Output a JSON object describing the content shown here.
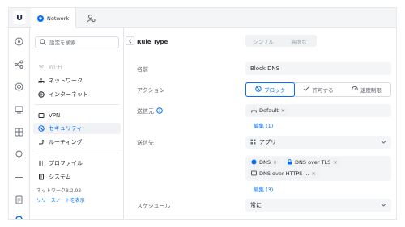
{
  "topbar": {
    "logo_letter": "U",
    "tab_network_label": "Network",
    "accent_color": "#006fff"
  },
  "rail_icons": [
    "dashboard-icon",
    "topology-icon",
    "devices-icon",
    "clients-icon",
    "stats-icon",
    "insights-icon",
    "alerts-icon",
    "logs-icon",
    "settings-icon"
  ],
  "nav": {
    "search_placeholder": "設定を検索",
    "items": [
      {
        "label": "Wi-Fi",
        "icon": "wifi-icon"
      },
      {
        "label": "ネットワーク",
        "icon": "network-icon"
      },
      {
        "label": "インターネット",
        "icon": "globe-icon"
      },
      {
        "label": "VPN",
        "icon": "vpn-icon"
      },
      {
        "label": "セキュリティ",
        "icon": "shield-icon"
      },
      {
        "label": "ルーティング",
        "icon": "routing-icon"
      },
      {
        "label": "プロファイル",
        "icon": "profile-icon"
      },
      {
        "label": "システム",
        "icon": "system-icon"
      }
    ],
    "version": "ネットワーク8.2.93",
    "release_notes": "リリースノートを表示"
  },
  "form": {
    "rule_type_label": "Rule Type",
    "mode_simple": "シンプル",
    "mode_advanced": "高度な",
    "name_label": "名前",
    "name_value": "Block DNS",
    "action_label": "アクション",
    "action_block": "ブロック",
    "action_allow": "許可する",
    "action_limit": "速度制限",
    "source_label": "送信元",
    "source_chip": "Default",
    "source_edit": "編集 (1)",
    "dest_label": "送信先",
    "dest_select": "アプリ",
    "dest_chips": [
      "DNS",
      "DNS over TLS",
      "DNS over HTTPS ..."
    ],
    "dest_edit": "編集 (3)",
    "schedule_label": "スケジュール",
    "schedule_value": "常に"
  }
}
